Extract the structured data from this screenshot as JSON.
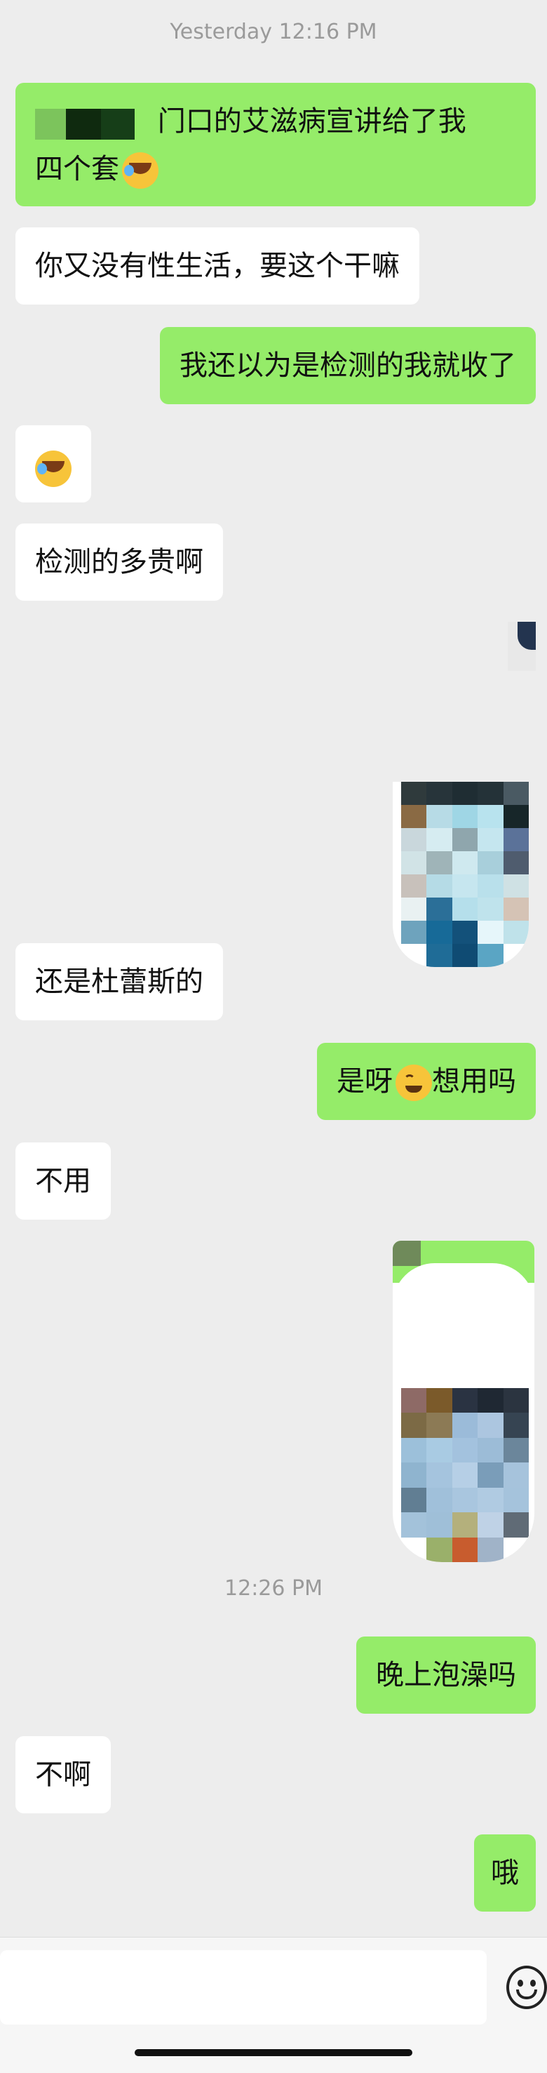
{
  "timestamps": [
    "Yesterday 12:16 PM",
    "12:26 PM"
  ],
  "messages": {
    "m1_text": "门口的艾滋病宣讲给了我",
    "m1_text2": "四个套",
    "m2": "你又没有性生活，要这个干嘛",
    "m3": "我还以为是检测的我就收了",
    "m5": "检测的多贵啊",
    "m6": "还是杜蕾斯的",
    "m7a": "是呀",
    "m7b": "想用吗",
    "m8": "不用",
    "m9": "晚上泡澡吗",
    "m10": "不啊",
    "m11": "哦"
  },
  "icons": {
    "laugh_emoji": "rolling-laughing-emoji",
    "smile_emoji": "grinning-emoji",
    "emoji_button": "smiley-face-icon"
  },
  "colors": {
    "background": "#ededed",
    "outgoing_bubble": "#95ec69",
    "incoming_bubble": "#ffffff",
    "timestamp": "#9a9a9a"
  }
}
